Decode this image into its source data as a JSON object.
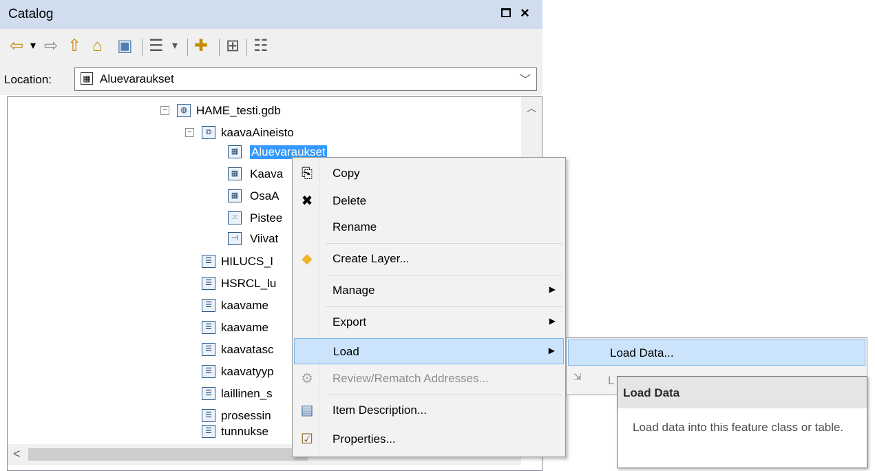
{
  "window": {
    "title": "Catalog",
    "maximize_icon": "maximize-icon",
    "close_label": "×"
  },
  "toolbar": {
    "buttons": [
      {
        "name": "back-icon",
        "glyph": "⇦"
      },
      {
        "name": "dropdown-icon",
        "glyph": "▾"
      },
      {
        "name": "forward-icon",
        "glyph": "⇨"
      },
      {
        "name": "up-one-level-icon",
        "glyph": "⇧"
      },
      {
        "name": "home-icon",
        "glyph": "⌂"
      },
      {
        "name": "connect-folder-icon",
        "glyph": "▣"
      },
      {
        "name": "view-list-icon",
        "glyph": "☰"
      },
      {
        "name": "view-dropdown-icon",
        "glyph": "▾"
      },
      {
        "name": "new-item-icon",
        "glyph": "✚"
      },
      {
        "name": "tree-view-icon",
        "glyph": "⊞"
      },
      {
        "name": "options-icon",
        "glyph": "☷"
      }
    ]
  },
  "location": {
    "label": "Location:",
    "value": "Aluevaraukset",
    "icon": "polygon-feature-class-icon",
    "arrow": "﹀"
  },
  "tree": {
    "expand_symbol": "−",
    "items": [
      {
        "label": "HAME_testi.gdb",
        "icon": "geodatabase-icon",
        "glyph": "◍"
      },
      {
        "label": "kaavaAineisto",
        "icon": "feature-dataset-icon",
        "glyph": "⧉"
      },
      {
        "label": "Aluevaraukset",
        "icon": "polygon-feature-class-icon",
        "glyph": "▦"
      },
      {
        "label": "Kaava",
        "icon": "polygon-feature-class-icon",
        "glyph": "▦"
      },
      {
        "label": "OsaA",
        "icon": "polygon-feature-class-icon",
        "glyph": "▦"
      },
      {
        "label": "Pistee",
        "icon": "point-feature-class-icon",
        "glyph": "⁙"
      },
      {
        "label": "Viivat",
        "icon": "line-feature-class-icon",
        "glyph": "⊣"
      },
      {
        "label": "HILUCS_l",
        "icon": "table-icon",
        "glyph": "☰"
      },
      {
        "label": "HSRCL_lu",
        "icon": "table-icon",
        "glyph": "☰"
      },
      {
        "label": "kaavame",
        "icon": "table-icon",
        "glyph": "☰"
      },
      {
        "label": "kaavame",
        "icon": "table-icon",
        "glyph": "☰"
      },
      {
        "label": "kaavatasc",
        "icon": "table-icon",
        "glyph": "☰"
      },
      {
        "label": "kaavatyyp",
        "icon": "table-icon",
        "glyph": "☰"
      },
      {
        "label": "laillinen_s",
        "icon": "table-icon",
        "glyph": "☰"
      },
      {
        "label": "prosessin",
        "icon": "table-icon",
        "glyph": "☰"
      },
      {
        "label": "tunnukse",
        "icon": "table-icon",
        "glyph": "☰"
      }
    ],
    "scroll_up": "︿",
    "scroll_left": "<"
  },
  "context_menu": {
    "items": [
      {
        "label": "Copy",
        "icon": "copy-icon",
        "glyph": "⎘"
      },
      {
        "label": "Delete",
        "icon": "delete-icon",
        "glyph": "✖"
      },
      {
        "label": "Rename",
        "icon": "",
        "glyph": ""
      },
      {
        "label": "Create Layer...",
        "icon": "create-layer-icon",
        "glyph": "◆"
      },
      {
        "label": "Manage",
        "icon": "",
        "glyph": ""
      },
      {
        "label": "Export",
        "icon": "",
        "glyph": ""
      },
      {
        "label": "Load",
        "icon": "",
        "glyph": ""
      },
      {
        "label": "Review/Rematch Addresses...",
        "icon": "review-rematch-icon",
        "glyph": "⚙"
      },
      {
        "label": "Item Description...",
        "icon": "item-description-icon",
        "glyph": "▤"
      },
      {
        "label": "Properties...",
        "icon": "properties-icon",
        "glyph": "☑"
      }
    ],
    "submenu_arrow": "▶"
  },
  "submenu": {
    "items": [
      {
        "label": "Load Data..."
      },
      {
        "label": "L",
        "icon": "load-objects-icon",
        "glyph": "⇲"
      }
    ]
  },
  "tooltip": {
    "title": "Load Data",
    "text": "Load data into this feature class or table."
  },
  "colors": {
    "titlebar": "#cfddee",
    "selection": "#3399ff",
    "highlight": "#cce4fb"
  }
}
